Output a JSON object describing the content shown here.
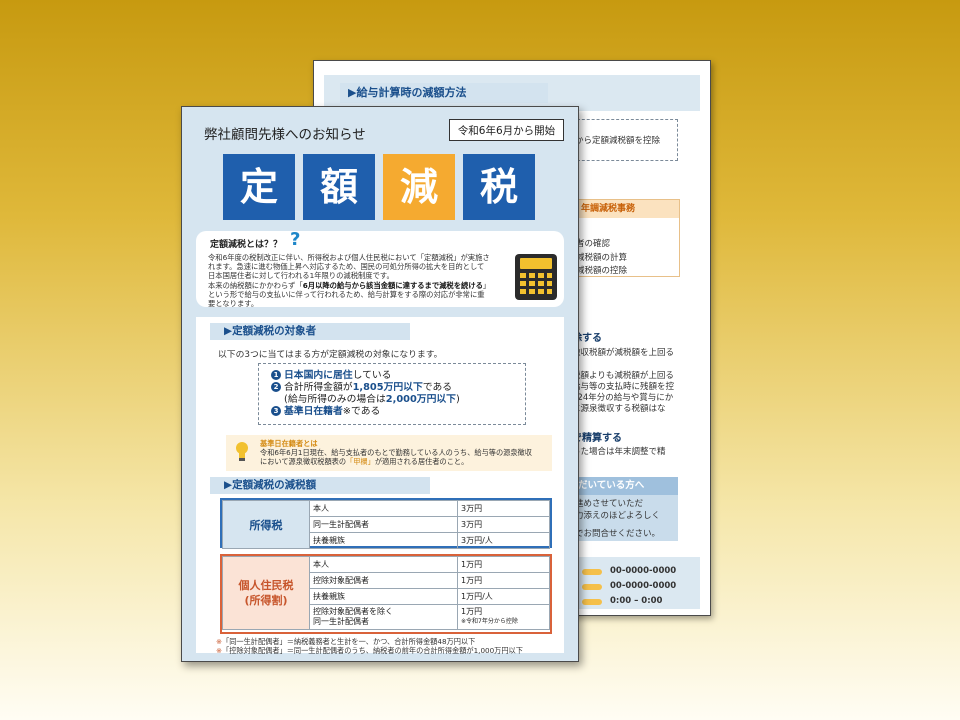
{
  "back_page": {
    "section_heading": "▶給与計算時の減額方法",
    "dash_box_text": "から定額減税額を控除",
    "nencho": {
      "heading": "年調減税事務",
      "lines": [
        "者の確認",
        "減税額の計算",
        "減税額の控除"
      ]
    },
    "block1": {
      "heading": "除する",
      "lines": [
        "徴収税額が減税額を上回る",
        "",
        "税額よりも減税額が上回る",
        "給与等の支払時に残額を控",
        "024年分の給与や賞与にか",
        "に源泉徴収する税額はな"
      ]
    },
    "block2": {
      "heading": "で精算する",
      "lines": [
        "った場合は年末調整で精"
      ]
    },
    "contact": {
      "heading": "だいている方へ",
      "lines": [
        "進めさせていただ",
        "力添えのほどよろしく",
        "",
        "でお問合せください。"
      ]
    },
    "bottom_rows": [
      "00-0000-0000",
      "00-0000-0000",
      "0:00 – 0:00"
    ]
  },
  "front_page": {
    "notice": "弊社顧問先様へのお知らせ",
    "start_badge": "令和6年6月から開始",
    "title_tiles": [
      {
        "char": "定",
        "color": "#1f5fad"
      },
      {
        "char": "額",
        "color": "#1f5fad"
      },
      {
        "char": "減",
        "color": "#f5aa30"
      },
      {
        "char": "税",
        "color": "#1f5fad"
      }
    ],
    "what_is": {
      "title": "定額減税とは？？",
      "question_mark": "?",
      "line1": "令和6年度の税制改正に伴い、所得税および個人住民税において「定額減税」が実施さ",
      "line2": "れます。急速に進む物価上昇へ対応するため、国民の可処分所得の拡大を目的として",
      "line3": "日本国居住者に対して行われる1年限りの減税制度です。",
      "line4_pre": "本来の納税額にかかわらず「",
      "line4_em": "6月以降の給与から該当金額に達するまで減税を続ける",
      "line4_post": "」",
      "line5": "という形で給与の支払いに伴って行われるため、給与計算をする際の対応が非常に重",
      "line6": "要となります。"
    },
    "targets": {
      "heading": "▶定額減税の対象者",
      "intro": "以下の3つに当てはまる方が定額減税の対象になります。",
      "item1_num": "1",
      "item1_a": "日本国内に居住",
      "item1_b": "している",
      "item2_num": "2",
      "item2_a": "合計所得金額が",
      "item2_b": "1,805万円以下",
      "item2_c": "である",
      "item2_sub_a": "(給与所得のみの場合は",
      "item2_sub_b": "2,000万円以下",
      "item2_sub_c": ")",
      "item3_num": "3",
      "item3_a": "基準日在籍者",
      "item3_b": "※である"
    },
    "kijun": {
      "title": "基準日在籍者とは",
      "line1": "令和6年6月1日現在、給与支払者のもとで勤務している人のうち、給与等の源泉徴収",
      "line2_pre": "において源泉徴収税額表の",
      "line2_hl": "「甲欄」",
      "line2_post": "が適用される居住者のこと。"
    },
    "amounts": {
      "heading": "▶定額減税の減税額",
      "income_tax": {
        "label": "所得税",
        "rows": [
          {
            "item": "本人",
            "amount": "3万円"
          },
          {
            "item": "同一生計配偶者",
            "amount": "3万円"
          },
          {
            "item": "扶養親族",
            "amount": "3万円/人"
          }
        ]
      },
      "resident_tax": {
        "label1": "個人住民税",
        "label2": "(所得割)",
        "rows": [
          {
            "item": "本人",
            "amount": "1万円",
            "item2": "",
            "note": ""
          },
          {
            "item": "控除対象配偶者",
            "amount": "1万円",
            "item2": "",
            "note": ""
          },
          {
            "item": "扶養親族",
            "amount": "1万円/人",
            "item2": "",
            "note": ""
          },
          {
            "item": "控除対象配偶者を除く",
            "item2": "同一生計配偶者",
            "amount": "1万円",
            "note": "※令和7年分から控除"
          }
        ]
      },
      "note1_mark": "※",
      "note1": "「同一生計配偶者」＝納税義務者と生計を一、かつ、合計所得金額48万円以下",
      "note2_mark": "※",
      "note2": "「控除対象配偶者」＝同一生計配偶者のうち、納税者の前年の合計所得金額が1,000万円以下"
    }
  }
}
